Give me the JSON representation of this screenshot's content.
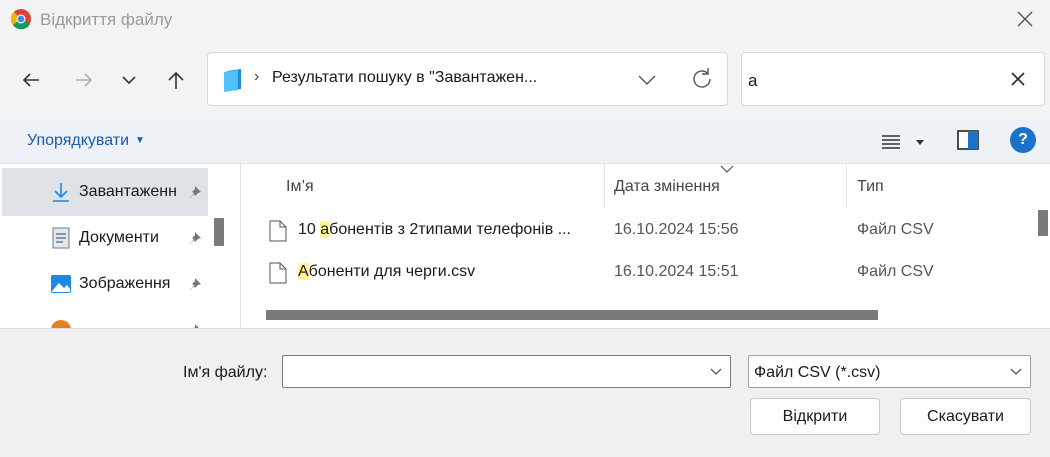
{
  "window": {
    "title": "Відкриття файлу"
  },
  "navigation": {
    "address_separator": "›",
    "address_text": "Результати пошуку в \"Завантажен...",
    "search_value": "а"
  },
  "commandbar": {
    "organize_label": "Упорядкувати"
  },
  "sidebar": {
    "items": [
      {
        "label": "Завантаженн"
      },
      {
        "label": "Документи"
      },
      {
        "label": "Зображення"
      }
    ]
  },
  "file_list": {
    "columns": {
      "name": "Ім’я",
      "date": "Дата змінення",
      "type": "Тип"
    },
    "rows": [
      {
        "name_prefix": "10 ",
        "name_highlight": "а",
        "name_rest": "бонентів з 2типами телефонів ...",
        "date": "16.10.2024 15:56",
        "type": "Файл CSV"
      },
      {
        "name_prefix": "",
        "name_highlight": "А",
        "name_rest": "боненти для черги.csv",
        "date": "16.10.2024 15:51",
        "type": "Файл CSV"
      }
    ]
  },
  "bottom": {
    "filename_label": "Ім'я файлу:",
    "filename_value": "",
    "filetype_value": "Файл CSV (*.csv)",
    "open_label": "Відкрити",
    "cancel_label": "Скасувати"
  },
  "colors": {
    "accent": "#1b5bb3",
    "highlight": "#fff59a",
    "help": "#1a73c8"
  }
}
